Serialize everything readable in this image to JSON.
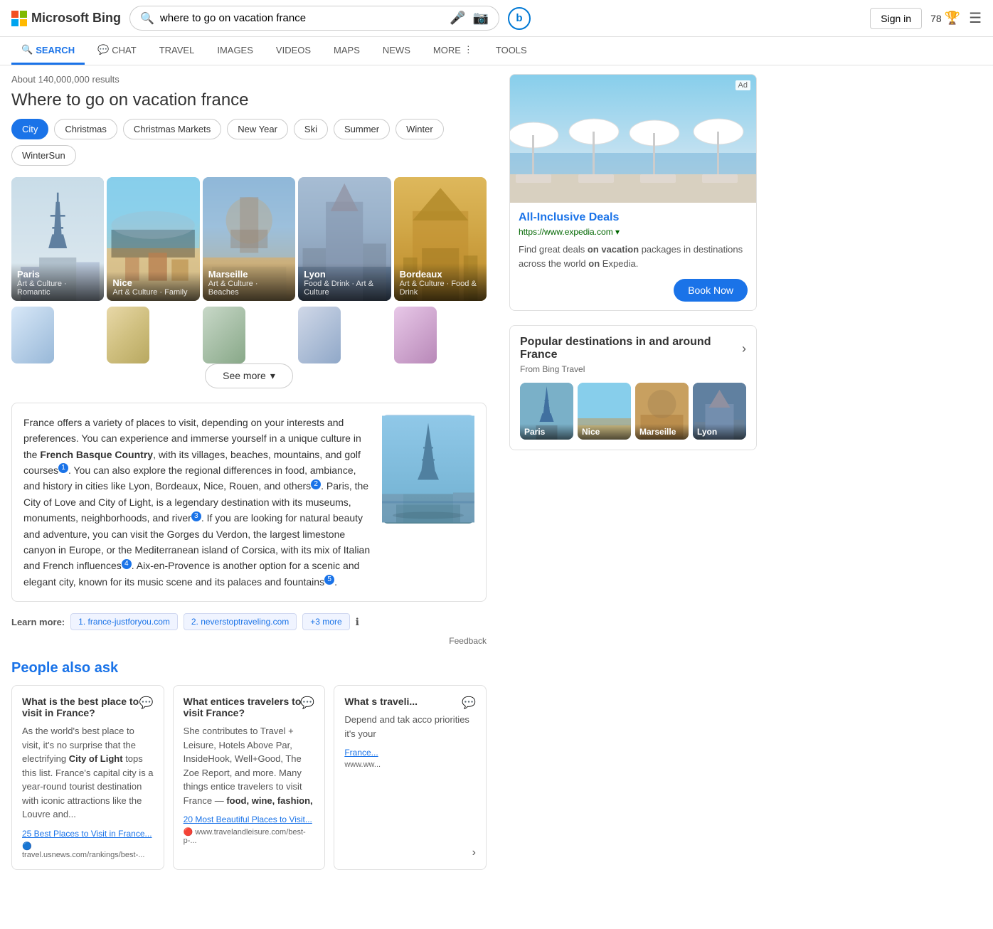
{
  "header": {
    "logo_text": "Microsoft Bing",
    "search_value": "where to go on vacation france",
    "sign_in": "Sign in",
    "score": "78",
    "mic_icon": "🎤",
    "camera_icon": "📷",
    "bing_icon": "b"
  },
  "nav": {
    "items": [
      {
        "id": "search",
        "label": "SEARCH",
        "icon": "🔍",
        "active": true
      },
      {
        "id": "chat",
        "label": "CHAT",
        "icon": "💬",
        "active": false
      },
      {
        "id": "travel",
        "label": "TRAVEL",
        "icon": "",
        "active": false
      },
      {
        "id": "images",
        "label": "IMAGES",
        "icon": "",
        "active": false
      },
      {
        "id": "videos",
        "label": "VIDEOS",
        "icon": "",
        "active": false
      },
      {
        "id": "maps",
        "label": "MAPS",
        "icon": "",
        "active": false
      },
      {
        "id": "news",
        "label": "NEWS",
        "icon": "",
        "active": false
      },
      {
        "id": "more",
        "label": "MORE",
        "icon": "",
        "active": false
      },
      {
        "id": "tools",
        "label": "TOOLS",
        "icon": "",
        "active": false
      }
    ]
  },
  "results": {
    "count": "About 140,000,000 results",
    "title": "Where to go on vacation france",
    "filters": [
      {
        "id": "city",
        "label": "City",
        "active": true
      },
      {
        "id": "christmas",
        "label": "Christmas",
        "active": false
      },
      {
        "id": "christmas-markets",
        "label": "Christmas Markets",
        "active": false
      },
      {
        "id": "new-year",
        "label": "New Year",
        "active": false
      },
      {
        "id": "ski",
        "label": "Ski",
        "active": false
      },
      {
        "id": "summer",
        "label": "Summer",
        "active": false
      },
      {
        "id": "winter",
        "label": "Winter",
        "active": false
      },
      {
        "id": "wintersun",
        "label": "WinterSun",
        "active": false
      }
    ],
    "cities_row1": [
      {
        "id": "paris",
        "name": "Paris",
        "tags": "Art & Culture · Romantic",
        "bg": "paris-bg"
      },
      {
        "id": "nice",
        "name": "Nice",
        "tags": "Art & Culture · Family",
        "bg": "nice-bg"
      },
      {
        "id": "marseille",
        "name": "Marseille",
        "tags": "Art & Culture · Beaches",
        "bg": "marseille-bg"
      },
      {
        "id": "lyon",
        "name": "Lyon",
        "tags": "Food & Drink · Art & Culture",
        "bg": "lyon-bg"
      },
      {
        "id": "bordeaux",
        "name": "Bordeaux",
        "tags": "Art & Culture · Food & Drink",
        "bg": "bordeaux-bg"
      }
    ],
    "cities_row2": [
      {
        "id": "r2-1",
        "bg": "row2-1"
      },
      {
        "id": "r2-2",
        "bg": "row2-2"
      },
      {
        "id": "r2-3",
        "bg": "row2-3"
      },
      {
        "id": "r2-4",
        "bg": "row2-4"
      },
      {
        "id": "r2-5",
        "bg": "row2-5"
      }
    ],
    "see_more": "See more",
    "info_text_1": "France offers a variety of places to visit, depending on your interests and preferences. You can experience and immerse yourself in a unique culture in the ",
    "info_bold_1": "French Basque Country",
    "info_text_2": ", with its villages, beaches, mountains, and golf courses",
    "info_ref_1": "1",
    "info_text_3": ". You can also explore the regional differences in food, ambiance, and history in cities like Lyon, Bordeaux, Nice, Rouen, and others",
    "info_ref_2": "2",
    "info_text_4": ". Paris, the City of Love and City of Light, is a legendary destination with its museums, monuments, neighborhoods, and river",
    "info_ref_3": "3",
    "info_text_5": ". If you are looking for natural beauty and adventure, you can visit the Gorges du Verdon, the largest limestone canyon in Europe, or the Mediterranean island of Corsica, with its mix of Italian and French influences",
    "info_ref_4": "4",
    "info_text_6": ". Aix-en-Provence is another option for a scenic and elegant city, known for its music scene and its palaces and fountains",
    "info_ref_5": "5",
    "info_text_7": ".",
    "learn_more_label": "Learn more:",
    "source_1": "1. france-justforyou.com",
    "source_2": "2. neverstoptraveling.com",
    "source_more": "+3 more",
    "feedback": "Feedback",
    "paa_title": "People also ask",
    "paa_items": [
      {
        "question": "What is the best place to visit in France?",
        "excerpt_pre": "As the world's best place to visit, it's no surprise that the electrifying ",
        "excerpt_bold": "City of Light",
        "excerpt_post": " tops this list. France's capital city is a year-round tourist destination with iconic attractions like the Louvre and...",
        "link": "25 Best Places to Visit in France...",
        "source": "travel.usnews.com/rankings/best-..."
      },
      {
        "question": "What entices travelers to visit France?",
        "excerpt_pre": "She contributes to Travel + Leisure, Hotels Above Par, InsideHook, Well+Good, The Zoe Report, and more. Many things entice travelers to visit France — ",
        "excerpt_bold": "food, wine, fashion,",
        "excerpt_post": "",
        "link": "20 Most Beautiful Places to Visit...",
        "source": "www.travelandleisure.com/best-p-..."
      },
      {
        "question": "What s traveli...",
        "excerpt_pre": "Depend and tak acco priorities it's your",
        "excerpt_bold": "",
        "excerpt_post": "",
        "link": "France...",
        "source": "www.ww..."
      }
    ]
  },
  "sidebar": {
    "ad_label": "Ad",
    "ad_img_alt": "Resort with umbrellas and ocean view",
    "ad_title": "All-Inclusive Deals",
    "ad_url": "https://www.expedia.com ▾",
    "ad_desc_pre": "Find great deals ",
    "ad_bold_1": "on vacation",
    "ad_desc_mid": " packages in destinations across the world ",
    "ad_bold_2": "on",
    "ad_desc_post": " Expedia.",
    "book_btn": "Book Now",
    "pop_title": "Popular destinations in and around France",
    "pop_sub": "From Bing Travel",
    "pop_cities": [
      {
        "name": "Paris",
        "bg": "paris-dest"
      },
      {
        "name": "Nice",
        "bg": "nice-dest"
      },
      {
        "name": "Marseille",
        "bg": "marseille-dest"
      },
      {
        "name": "Lyon",
        "bg": "lyon-dest"
      }
    ]
  }
}
